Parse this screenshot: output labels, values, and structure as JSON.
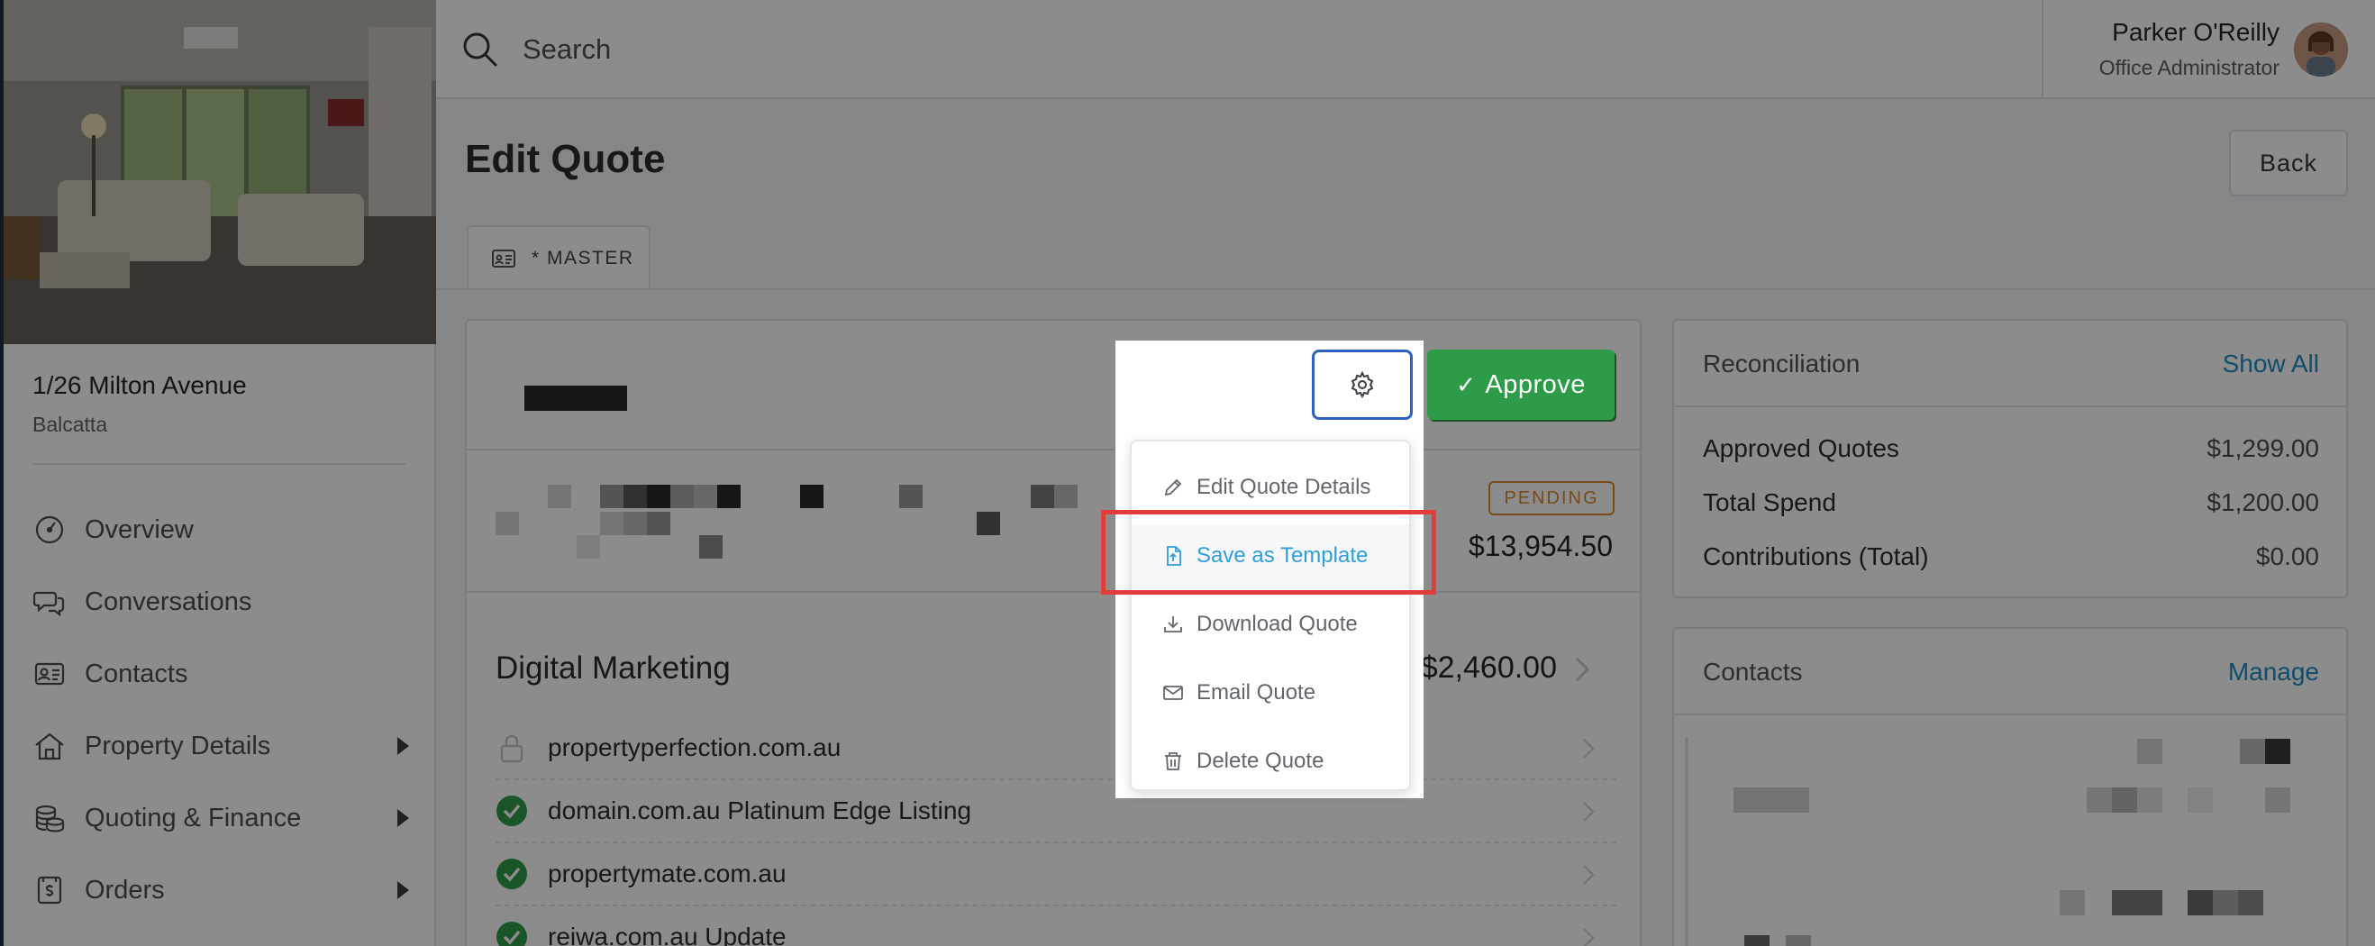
{
  "sidebar": {
    "address": "1/26 Milton Avenue",
    "suburb": "Balcatta",
    "nav": [
      {
        "label": "Overview",
        "icon": "gauge-icon"
      },
      {
        "label": "Conversations",
        "icon": "chat-bubbles-icon"
      },
      {
        "label": "Contacts",
        "icon": "id-card-icon"
      },
      {
        "label": "Property Details",
        "icon": "house-icon",
        "expandable": true
      },
      {
        "label": "Quoting & Finance",
        "icon": "coins-icon",
        "expandable": true
      },
      {
        "label": "Orders",
        "icon": "invoice-icon",
        "expandable": true
      }
    ]
  },
  "topbar": {
    "search_placeholder": "Search",
    "user_name": "Parker O'Reilly",
    "user_role": "Office Administrator"
  },
  "page": {
    "title": "Edit Quote",
    "back_label": "Back",
    "tab_label": "* MASTER"
  },
  "quote": {
    "approve_label": "Approve",
    "status": "PENDING",
    "total": "$13,954.50",
    "section_title": "Digital Marketing",
    "section_amount": "$2,460.00",
    "items": [
      {
        "label": "propertyperfection.com.au",
        "state": "locked"
      },
      {
        "label": "domain.com.au Platinum Edge Listing",
        "state": "approved"
      },
      {
        "label": "propertymate.com.au",
        "state": "approved"
      },
      {
        "label": "reiwa.com.au Update",
        "state": "approved"
      }
    ]
  },
  "reconciliation": {
    "title": "Reconciliation",
    "link": "Show All",
    "rows": [
      {
        "label": "Approved Quotes",
        "value": "$1,299.00"
      },
      {
        "label": "Total Spend",
        "value": "$1,200.00"
      },
      {
        "label": "Contributions (Total)",
        "value": "$0.00"
      }
    ]
  },
  "contacts_panel": {
    "title": "Contacts",
    "link": "Manage"
  },
  "dropdown": {
    "items": [
      {
        "label": "Edit Quote Details",
        "icon": "pencil-icon"
      },
      {
        "label": "Save as Template",
        "icon": "file-template-icon",
        "active": true
      },
      {
        "label": "Download Quote",
        "icon": "download-icon"
      },
      {
        "label": "Email Quote",
        "icon": "envelope-icon"
      },
      {
        "label": "Delete Quote",
        "icon": "trash-icon"
      }
    ]
  },
  "colors": {
    "approve": "#2e9b48",
    "link": "#1e8bc3",
    "pending": "#d98a2c",
    "active_menu": "#2f9ed8",
    "highlight": "#e23d3d",
    "gear_border": "#2f62c0"
  }
}
